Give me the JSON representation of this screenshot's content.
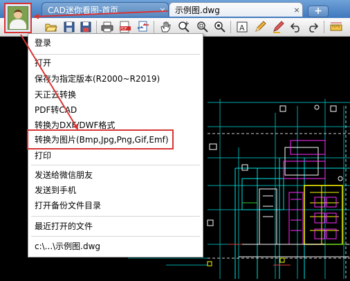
{
  "tabs": [
    {
      "label": "CAD迷你看图-首页",
      "close": "×"
    },
    {
      "label": "示例图.dwg",
      "close": "×"
    }
  ],
  "new_tab_label": "+",
  "toolbar_icons": [
    "open-folder-icon",
    "save-icon",
    "save-as-icon",
    "print-icon",
    "pdf-export-icon",
    "convert-icon",
    "pan-icon",
    "zoom-in-icon",
    "zoom-window-icon",
    "zoom-realtime-icon",
    "text-icon",
    "pencil-icon",
    "highlighter-icon",
    "undo-icon",
    "redo-icon",
    "measure-icon"
  ],
  "menu": {
    "login": "登录",
    "open": "打开",
    "save_as_version": "保存为指定版本(R2000~R2019)",
    "tangent_cloud": "天正云转换",
    "pdf_to_cad": "PDF转CAD",
    "convert_dxf": "转换为DXF/DWF格式",
    "convert_image": "转换为图片(Bmp,Jpg,Png,Gif,Emf)",
    "print": "打印",
    "send_wechat": "发送给微信朋友",
    "send_phone": "发送到手机",
    "open_backup": "打开备份文件目录",
    "recent_files": "最近打开的文件",
    "recent_path": "c:\\...\\示例图.dwg"
  },
  "colors": {
    "annotation_red": "#d83434",
    "tab_blue": "#3f78bd",
    "canvas": "#000000",
    "cad_cyan": "#00e5e5",
    "cad_magenta": "#ff2cff",
    "cad_yellow": "#ffff00",
    "cad_white": "#ffffff"
  }
}
